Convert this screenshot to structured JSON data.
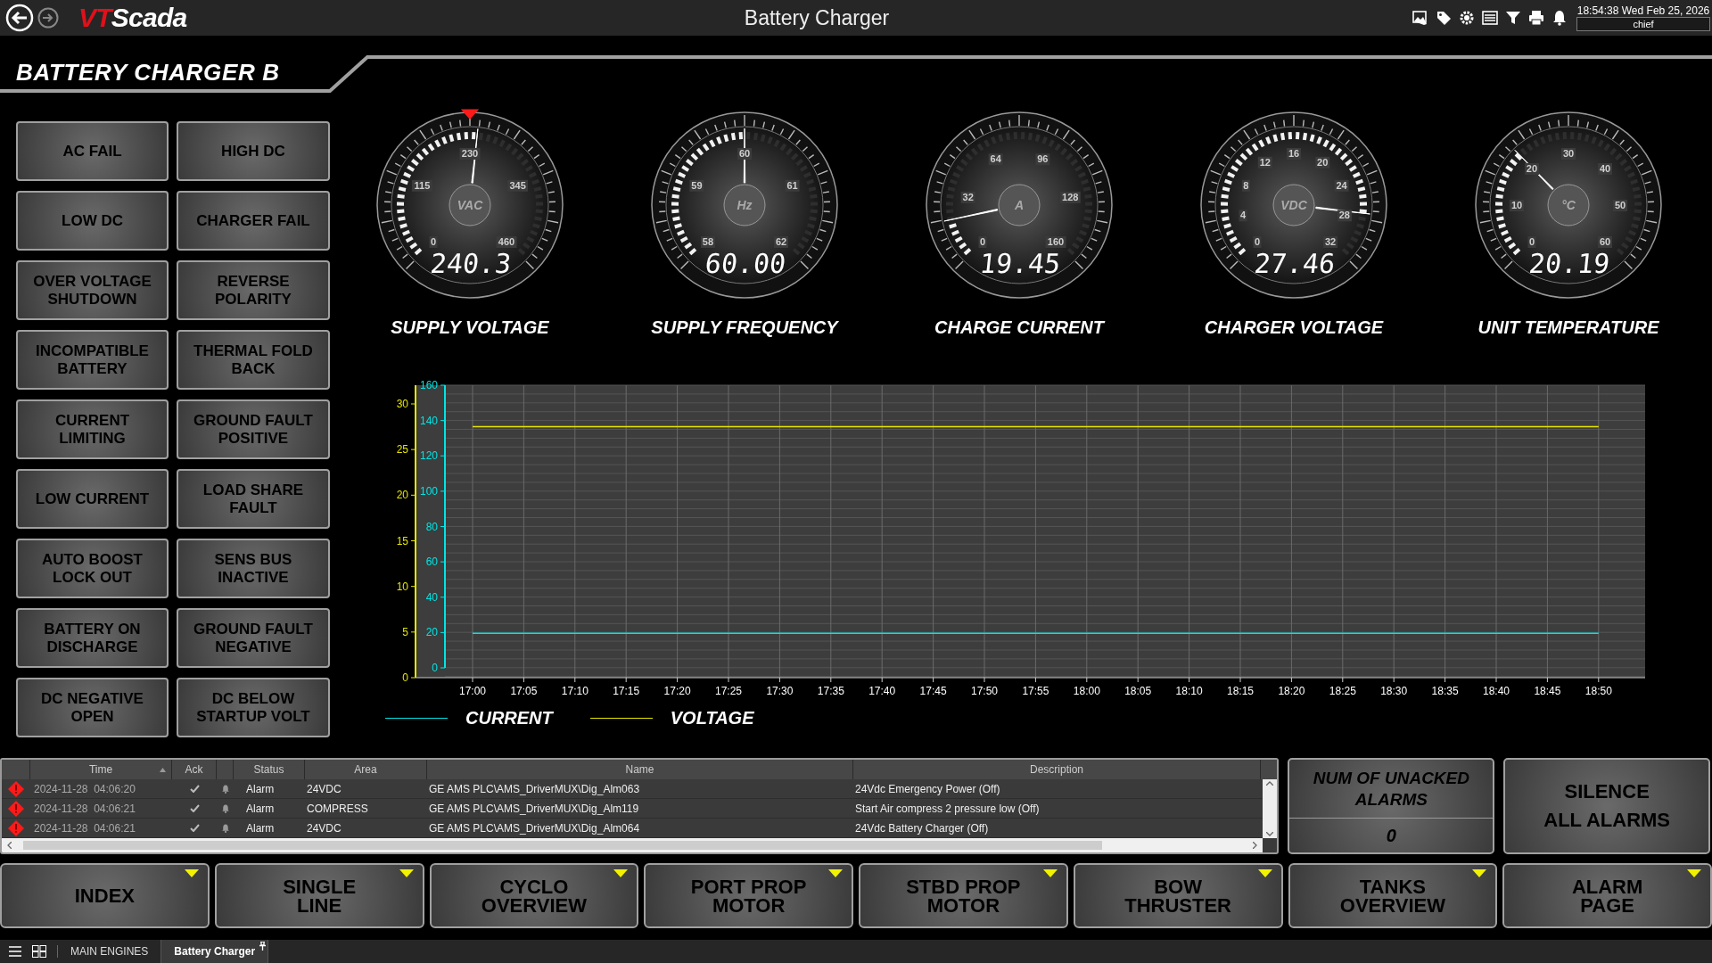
{
  "top_bar": {
    "logo": "VTScada",
    "title": "Battery Charger",
    "clock": "18:54:38  Wed Feb 25, 2026",
    "user": "chief"
  },
  "page_title": "BATTERY CHARGER B",
  "alarm_buttons": [
    {
      "label": "AC FAIL"
    },
    {
      "label": "HIGH DC"
    },
    {
      "label": "LOW DC"
    },
    {
      "label": "CHARGER FAIL"
    },
    {
      "label": "OVER VOLTAGE\nSHUTDOWN"
    },
    {
      "label": "REVERSE\nPOLARITY"
    },
    {
      "label": "INCOMPATIBLE\nBATTERY"
    },
    {
      "label": "THERMAL FOLD\nBACK"
    },
    {
      "label": "CURRENT\nLIMITING"
    },
    {
      "label": "GROUND FAULT\nPOSITIVE"
    },
    {
      "label": "LOW CURRENT"
    },
    {
      "label": "LOAD SHARE\nFAULT"
    },
    {
      "label": "AUTO BOOST\nLOCK OUT"
    },
    {
      "label": "SENS BUS\nINACTIVE"
    },
    {
      "label": "BATTERY ON\nDISCHARGE"
    },
    {
      "label": "GROUND FAULT\nNEGATIVE"
    },
    {
      "label": "DC NEGATIVE\nOPEN"
    },
    {
      "label": "DC BELOW\nSTARTUP VOLT"
    }
  ],
  "gauges": [
    {
      "label": "SUPPLY VOLTAGE",
      "unit": "VAC",
      "reading": "240.3",
      "level": 0.522,
      "setpoint": {
        "level": 0.5
      },
      "scale": [
        "0",
        "115",
        "230",
        "345",
        "460"
      ]
    },
    {
      "label": "SUPPLY FREQUENCY",
      "unit": "Hz",
      "reading": "60.00",
      "level": 0.5,
      "scale": [
        "58",
        "59",
        "60",
        "61",
        "62"
      ]
    },
    {
      "label": "CHARGE CURRENT",
      "unit": "A",
      "reading": "19.45",
      "level": 0.122,
      "scale": [
        "0",
        "32",
        "64",
        "96",
        "128",
        "160"
      ]
    },
    {
      "label": "CHARGER VOLTAGE",
      "unit": "VDC",
      "reading": "27.46",
      "level": 0.858,
      "scale": [
        "0",
        "4",
        "8",
        "12",
        "16",
        "20",
        "24",
        "28",
        "32"
      ]
    },
    {
      "label": "UNIT TEMPERATURE",
      "unit": "°C",
      "reading": "20.19",
      "level": 0.336,
      "scale": [
        "0",
        "10",
        "20",
        "30",
        "40",
        "50",
        "60"
      ]
    }
  ],
  "trend": {
    "chart_data": {
      "type": "line",
      "grid": true,
      "legend": true,
      "categories": [
        "17:00",
        "17:05",
        "17:10",
        "17:15",
        "17:20",
        "17:25",
        "17:30",
        "17:35",
        "17:40",
        "17:45",
        "17:50",
        "17:55",
        "18:00",
        "18:05",
        "18:10",
        "18:15",
        "18:20",
        "18:25",
        "18:30",
        "18:35",
        "18:40",
        "18:45",
        "18:50"
      ],
      "ylim": [
        0,
        30
      ],
      "yticks": [
        {
          "value": 0,
          "label": "0"
        },
        {
          "value": 5,
          "label": "5"
        },
        {
          "value": 10,
          "label": "10"
        },
        {
          "value": 15,
          "label": "15"
        },
        {
          "value": 20,
          "label": "20"
        },
        {
          "value": 25,
          "label": "25"
        },
        {
          "value": 30,
          "label": "30"
        }
      ],
      "y2lim": [
        0,
        160
      ],
      "y2ticks": [
        {
          "value": 0,
          "label": "0"
        },
        {
          "value": 20,
          "label": "20"
        },
        {
          "value": 40,
          "label": "40"
        },
        {
          "value": 60,
          "label": "60"
        },
        {
          "value": 80,
          "label": "80"
        },
        {
          "value": 100,
          "label": "100"
        },
        {
          "value": 120,
          "label": "120"
        },
        {
          "value": 140,
          "label": "140"
        },
        {
          "value": 160,
          "label": "160"
        }
      ],
      "series": [
        {
          "name": "CURRENT",
          "color": "#00e5e5",
          "axis": "y2",
          "values": [
            19.5,
            19.5,
            19.5,
            19.5,
            19.5,
            19.5,
            19.5,
            19.5,
            19.5,
            19.5,
            19.5,
            19.5,
            19.5,
            19.5,
            19.5,
            19.5,
            19.5,
            19.5,
            19.5,
            19.5,
            19.5,
            19.5,
            19.5
          ]
        },
        {
          "name": "VOLTAGE",
          "color": "#e5e500",
          "axis": "y",
          "values": [
            27.5,
            27.5,
            27.5,
            27.5,
            27.5,
            27.5,
            27.5,
            27.5,
            27.5,
            27.5,
            27.5,
            27.5,
            27.5,
            27.5,
            27.5,
            27.5,
            27.5,
            27.5,
            27.5,
            27.5,
            27.5,
            27.5,
            27.5
          ]
        }
      ]
    }
  },
  "alarm_list": {
    "columns": [
      "Time",
      "Ack",
      "Status",
      "Area",
      "Name",
      "Description"
    ],
    "rows": [
      {
        "time": "2024-11-28  04:06:20",
        "acked": true,
        "status": "Alarm",
        "area": "24VDC",
        "name": "GE AMS PLC\\AMS_DriverMUX\\Dig_Alm063",
        "description": "24Vdc Emergency Power (Off)"
      },
      {
        "time": "2024-11-28  04:06:21",
        "acked": true,
        "status": "Alarm",
        "area": "COMPRESS",
        "name": "GE AMS PLC\\AMS_DriverMUX\\Dig_Alm119",
        "description": "Start Air compress 2 pressure low (Off)"
      },
      {
        "time": "2024-11-28  04:06:21",
        "acked": true,
        "status": "Alarm",
        "area": "24VDC",
        "name": "GE AMS PLC\\AMS_DriverMUX\\Dig_Alm064",
        "description": "24Vdc Battery Charger (Off)"
      }
    ]
  },
  "unacked": {
    "label": "NUM OF UNACKED ALARMS",
    "count": "0"
  },
  "silence_button": "SILENCE\nALL ALARMS",
  "nav_buttons": [
    "INDEX",
    "SINGLE\nLINE",
    "CYCLO\nOVERVIEW",
    "PORT PROP\nMOTOR",
    "STBD PROP\nMOTOR",
    "BOW\nTHRUSTER",
    "TANKS\nOVERVIEW",
    "ALARM\nPAGE"
  ],
  "taskbar_tabs": [
    {
      "label": "MAIN ENGINES",
      "selected": false,
      "pinned": false
    },
    {
      "label": "Battery Charger",
      "selected": true,
      "pinned": true
    }
  ]
}
